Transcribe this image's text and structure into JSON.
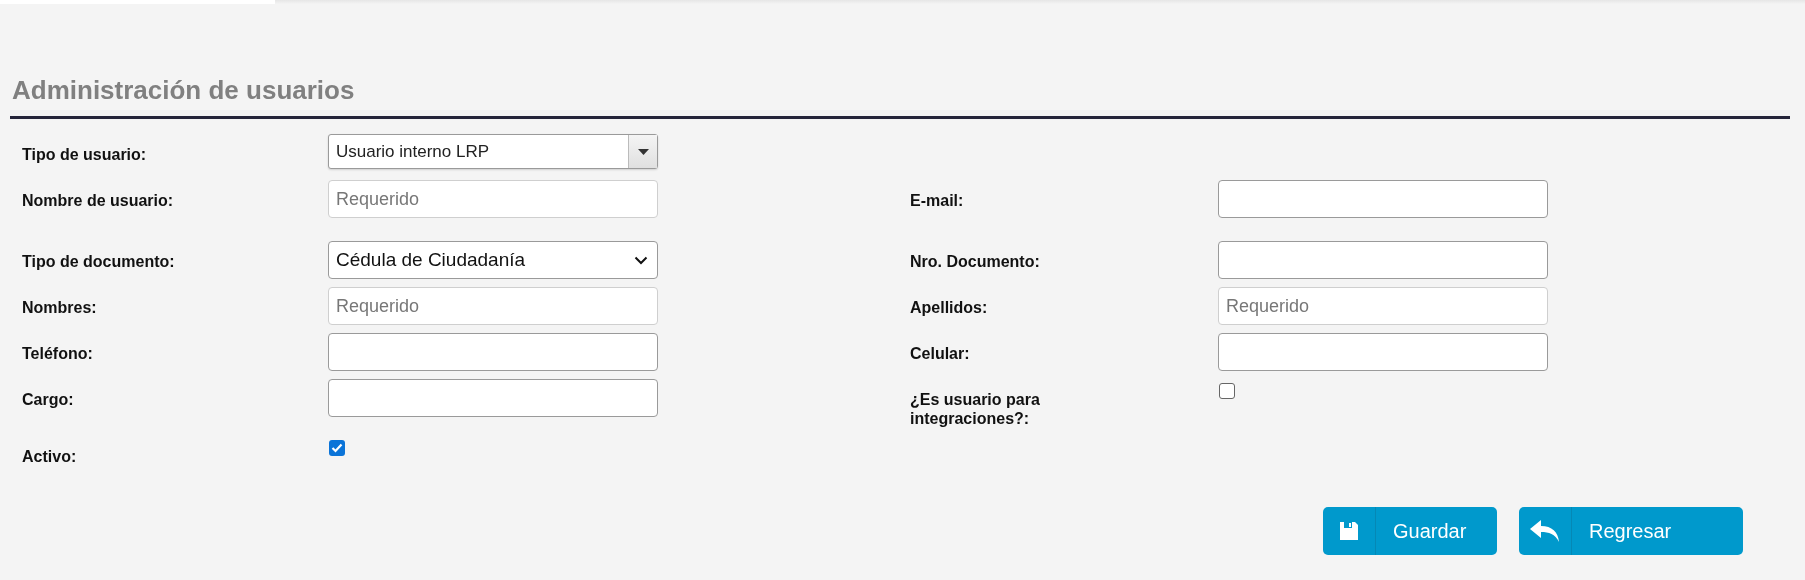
{
  "title": "Administración de usuarios",
  "sections": [
    {
      "rows": [
        {
          "left": {
            "label": "Tipo de usuario:",
            "kind": "combo",
            "value": "Usuario interno LRP"
          }
        },
        {
          "left": {
            "label": "Nombre de usuario:",
            "kind": "text",
            "placeholder": "Requerido"
          },
          "right": {
            "label": "E-mail:",
            "kind": "text"
          }
        }
      ]
    },
    {
      "rows": [
        {
          "left": {
            "label": "Tipo de documento:",
            "kind": "select",
            "value": "Cédula de Ciudadanía"
          },
          "right": {
            "label": "Nro. Documento:",
            "kind": "text"
          }
        },
        {
          "left": {
            "label": "Nombres:",
            "kind": "text",
            "placeholder": "Requerido"
          },
          "right": {
            "label": "Apellidos:",
            "kind": "text",
            "placeholder": "Requerido"
          }
        },
        {
          "left": {
            "label": "Teléfono:",
            "kind": "text"
          },
          "right": {
            "label": "Celular:",
            "kind": "text"
          }
        },
        {
          "left": {
            "label": "Cargo:",
            "kind": "text"
          },
          "right": {
            "label": "¿Es usuario para integraciones?:",
            "kind": "checkbox",
            "checked": false
          }
        },
        {
          "left": {
            "label": "Activo:",
            "kind": "checkbox",
            "checked": true
          }
        }
      ]
    }
  ],
  "buttons": [
    {
      "label": "Guardar",
      "kind": "save"
    },
    {
      "label": "Regresar",
      "kind": "back"
    }
  ]
}
